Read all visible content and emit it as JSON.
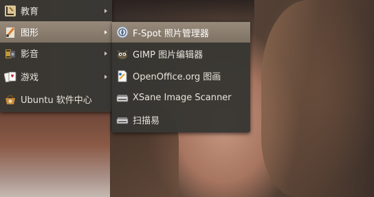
{
  "main_menu": {
    "items": [
      {
        "label": "教育",
        "icon": "education-icon",
        "has_submenu": true
      },
      {
        "label": "图形",
        "icon": "graphics-icon",
        "has_submenu": true,
        "active": true
      },
      {
        "label": "影音",
        "icon": "sound-video-icon",
        "has_submenu": true
      },
      {
        "label": "游戏",
        "icon": "games-icon",
        "has_submenu": true
      },
      {
        "label": "Ubuntu 软件中心",
        "icon": "software-center-icon",
        "has_submenu": false
      }
    ]
  },
  "submenu": {
    "items": [
      {
        "label": "F-Spot 照片管理器",
        "icon": "f-spot-icon",
        "active": true
      },
      {
        "label": "GIMP 图片编辑器",
        "icon": "gimp-icon"
      },
      {
        "label": "OpenOffice.org 图画",
        "icon": "openoffice-draw-icon"
      },
      {
        "label": "XSane Image Scanner",
        "icon": "scanner-icon"
      },
      {
        "label": "扫描易",
        "icon": "simple-scan-icon"
      }
    ]
  },
  "colors": {
    "menu_bg": "#3a3834",
    "highlight": "#8a7e70",
    "text": "#e8e4dc"
  }
}
